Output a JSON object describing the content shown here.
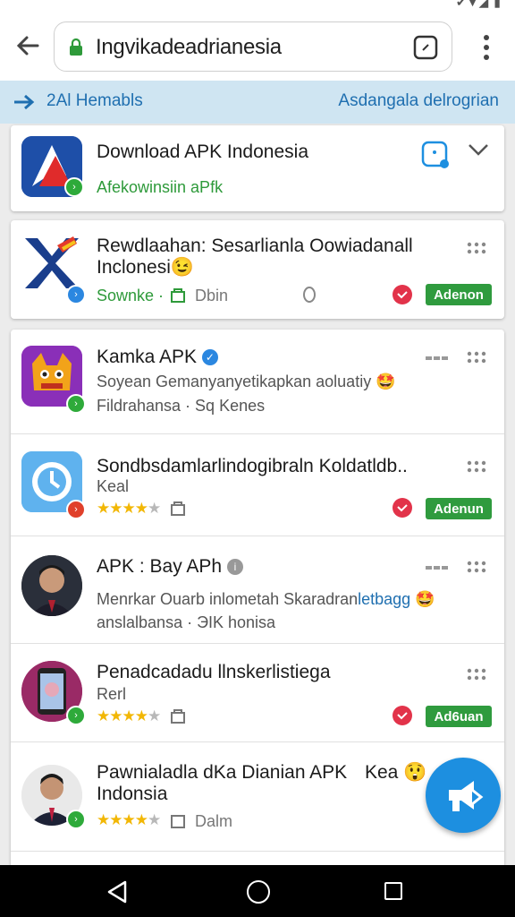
{
  "toolbar": {
    "url": "Ingvikadeadrianesia"
  },
  "banner": {
    "left": "2Al Hemabls",
    "right": "Asdangala delrogrian"
  },
  "featured": {
    "title": "Download APK Indonesia",
    "subtitle": "Afekowinsiin aPfk"
  },
  "sponsored": {
    "title_line1": "Rewdlaahan: Sesarlianla Oowiadanall",
    "title_line2": "Inclonesi",
    "title_emoji": "😉",
    "meta_left": "Sownke ·",
    "meta_right": "Dbin",
    "install": "Adenon"
  },
  "list": [
    {
      "title": "Kamka APK",
      "line2": "Soyean Gemanyanyetikapkan aoluatiy",
      "line2_emoji": "🤩",
      "line3": "Fildrahansa · Sq Kenes"
    },
    {
      "title": "Sondbsdamlarlindogibraln Koldatldb..",
      "line2": "Keal",
      "rating": 4,
      "install": "Adenun"
    },
    {
      "title": "APK : Bay APh",
      "line2_a": "Menrkar Ouarb inlometah Skaradran",
      "line2_b": "letbagg",
      "line2_emoji": "🤩",
      "line3": "anslalbansa · ЭIK honisa"
    },
    {
      "title": "Penadcadadu llnskerlistiega",
      "line2": "Rerl",
      "rating": 4,
      "install": "Ad6uan"
    },
    {
      "title_line1": "Pawnialadla dKa Dianian APK",
      "title_suffix": "Kea",
      "title_emoji": "😲",
      "title_line2": "Indonsia",
      "rating": 4,
      "meta_right": "Dalm"
    }
  ],
  "colors": {
    "accent": "#2f9b3e",
    "link": "#1f6fb0",
    "banner": "#cfe5f2",
    "fab": "#1d8fe0"
  }
}
